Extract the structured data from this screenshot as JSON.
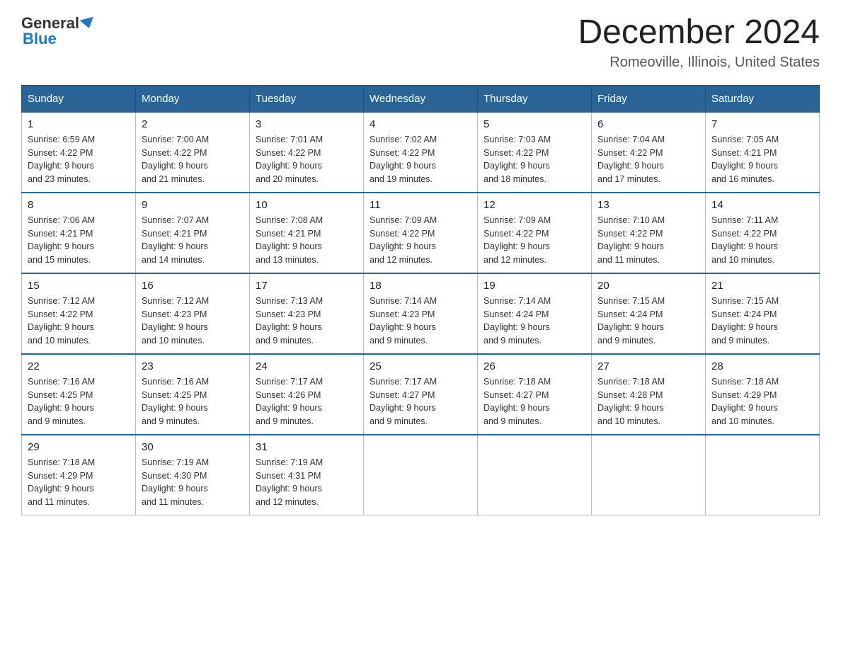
{
  "logo": {
    "general": "General",
    "blue": "Blue"
  },
  "title": {
    "month_year": "December 2024",
    "location": "Romeoville, Illinois, United States"
  },
  "weekdays": [
    "Sunday",
    "Monday",
    "Tuesday",
    "Wednesday",
    "Thursday",
    "Friday",
    "Saturday"
  ],
  "weeks": [
    [
      {
        "day": "1",
        "sunrise": "6:59 AM",
        "sunset": "4:22 PM",
        "daylight": "9 hours and 23 minutes."
      },
      {
        "day": "2",
        "sunrise": "7:00 AM",
        "sunset": "4:22 PM",
        "daylight": "9 hours and 21 minutes."
      },
      {
        "day": "3",
        "sunrise": "7:01 AM",
        "sunset": "4:22 PM",
        "daylight": "9 hours and 20 minutes."
      },
      {
        "day": "4",
        "sunrise": "7:02 AM",
        "sunset": "4:22 PM",
        "daylight": "9 hours and 19 minutes."
      },
      {
        "day": "5",
        "sunrise": "7:03 AM",
        "sunset": "4:22 PM",
        "daylight": "9 hours and 18 minutes."
      },
      {
        "day": "6",
        "sunrise": "7:04 AM",
        "sunset": "4:22 PM",
        "daylight": "9 hours and 17 minutes."
      },
      {
        "day": "7",
        "sunrise": "7:05 AM",
        "sunset": "4:21 PM",
        "daylight": "9 hours and 16 minutes."
      }
    ],
    [
      {
        "day": "8",
        "sunrise": "7:06 AM",
        "sunset": "4:21 PM",
        "daylight": "9 hours and 15 minutes."
      },
      {
        "day": "9",
        "sunrise": "7:07 AM",
        "sunset": "4:21 PM",
        "daylight": "9 hours and 14 minutes."
      },
      {
        "day": "10",
        "sunrise": "7:08 AM",
        "sunset": "4:21 PM",
        "daylight": "9 hours and 13 minutes."
      },
      {
        "day": "11",
        "sunrise": "7:09 AM",
        "sunset": "4:22 PM",
        "daylight": "9 hours and 12 minutes."
      },
      {
        "day": "12",
        "sunrise": "7:09 AM",
        "sunset": "4:22 PM",
        "daylight": "9 hours and 12 minutes."
      },
      {
        "day": "13",
        "sunrise": "7:10 AM",
        "sunset": "4:22 PM",
        "daylight": "9 hours and 11 minutes."
      },
      {
        "day": "14",
        "sunrise": "7:11 AM",
        "sunset": "4:22 PM",
        "daylight": "9 hours and 10 minutes."
      }
    ],
    [
      {
        "day": "15",
        "sunrise": "7:12 AM",
        "sunset": "4:22 PM",
        "daylight": "9 hours and 10 minutes."
      },
      {
        "day": "16",
        "sunrise": "7:12 AM",
        "sunset": "4:23 PM",
        "daylight": "9 hours and 10 minutes."
      },
      {
        "day": "17",
        "sunrise": "7:13 AM",
        "sunset": "4:23 PM",
        "daylight": "9 hours and 9 minutes."
      },
      {
        "day": "18",
        "sunrise": "7:14 AM",
        "sunset": "4:23 PM",
        "daylight": "9 hours and 9 minutes."
      },
      {
        "day": "19",
        "sunrise": "7:14 AM",
        "sunset": "4:24 PM",
        "daylight": "9 hours and 9 minutes."
      },
      {
        "day": "20",
        "sunrise": "7:15 AM",
        "sunset": "4:24 PM",
        "daylight": "9 hours and 9 minutes."
      },
      {
        "day": "21",
        "sunrise": "7:15 AM",
        "sunset": "4:24 PM",
        "daylight": "9 hours and 9 minutes."
      }
    ],
    [
      {
        "day": "22",
        "sunrise": "7:16 AM",
        "sunset": "4:25 PM",
        "daylight": "9 hours and 9 minutes."
      },
      {
        "day": "23",
        "sunrise": "7:16 AM",
        "sunset": "4:25 PM",
        "daylight": "9 hours and 9 minutes."
      },
      {
        "day": "24",
        "sunrise": "7:17 AM",
        "sunset": "4:26 PM",
        "daylight": "9 hours and 9 minutes."
      },
      {
        "day": "25",
        "sunrise": "7:17 AM",
        "sunset": "4:27 PM",
        "daylight": "9 hours and 9 minutes."
      },
      {
        "day": "26",
        "sunrise": "7:18 AM",
        "sunset": "4:27 PM",
        "daylight": "9 hours and 9 minutes."
      },
      {
        "day": "27",
        "sunrise": "7:18 AM",
        "sunset": "4:28 PM",
        "daylight": "9 hours and 10 minutes."
      },
      {
        "day": "28",
        "sunrise": "7:18 AM",
        "sunset": "4:29 PM",
        "daylight": "9 hours and 10 minutes."
      }
    ],
    [
      {
        "day": "29",
        "sunrise": "7:18 AM",
        "sunset": "4:29 PM",
        "daylight": "9 hours and 11 minutes."
      },
      {
        "day": "30",
        "sunrise": "7:19 AM",
        "sunset": "4:30 PM",
        "daylight": "9 hours and 11 minutes."
      },
      {
        "day": "31",
        "sunrise": "7:19 AM",
        "sunset": "4:31 PM",
        "daylight": "9 hours and 12 minutes."
      },
      null,
      null,
      null,
      null
    ]
  ],
  "labels": {
    "sunrise": "Sunrise:",
    "sunset": "Sunset:",
    "daylight": "Daylight:"
  }
}
